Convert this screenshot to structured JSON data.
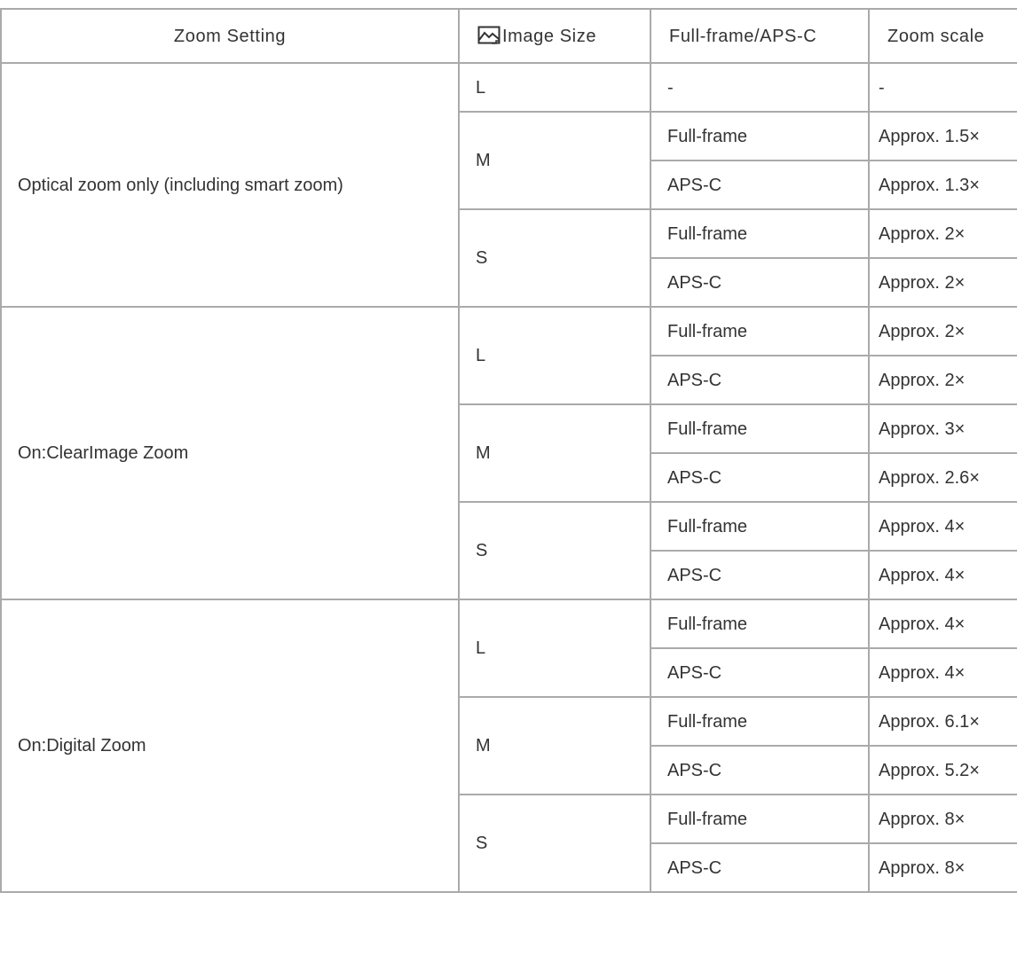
{
  "table": {
    "headers": {
      "zoom_setting": "Zoom Setting",
      "image_size": "Image Size",
      "image_size_icon": "image-size-icon",
      "frame": "Full-frame/APS-C",
      "zoom_scale": "Zoom scale"
    },
    "groups": [
      {
        "setting": "Optical zoom only (including smart zoom)",
        "sizes": [
          {
            "size": "L",
            "rows": [
              {
                "frame": "-",
                "scale": "-"
              }
            ]
          },
          {
            "size": "M",
            "rows": [
              {
                "frame": "Full-frame",
                "scale": "Approx. 1.5×"
              },
              {
                "frame": "APS-C",
                "scale": "Approx. 1.3×"
              }
            ]
          },
          {
            "size": "S",
            "rows": [
              {
                "frame": "Full-frame",
                "scale": "Approx. 2×"
              },
              {
                "frame": "APS-C",
                "scale": "Approx. 2×"
              }
            ]
          }
        ]
      },
      {
        "setting": "On:ClearImage Zoom",
        "sizes": [
          {
            "size": "L",
            "rows": [
              {
                "frame": "Full-frame",
                "scale": "Approx. 2×"
              },
              {
                "frame": "APS-C",
                "scale": "Approx. 2×"
              }
            ]
          },
          {
            "size": "M",
            "rows": [
              {
                "frame": "Full-frame",
                "scale": "Approx. 3×"
              },
              {
                "frame": "APS-C",
                "scale": "Approx. 2.6×"
              }
            ]
          },
          {
            "size": "S",
            "rows": [
              {
                "frame": "Full-frame",
                "scale": "Approx. 4×"
              },
              {
                "frame": "APS-C",
                "scale": "Approx. 4×"
              }
            ]
          }
        ]
      },
      {
        "setting": "On:Digital Zoom",
        "sizes": [
          {
            "size": "L",
            "rows": [
              {
                "frame": "Full-frame",
                "scale": "Approx. 4×"
              },
              {
                "frame": "APS-C",
                "scale": "Approx. 4×"
              }
            ]
          },
          {
            "size": "M",
            "rows": [
              {
                "frame": "Full-frame",
                "scale": "Approx. 6.1×"
              },
              {
                "frame": "APS-C",
                "scale": "Approx. 5.2×"
              }
            ]
          },
          {
            "size": "S",
            "rows": [
              {
                "frame": "Full-frame",
                "scale": "Approx. 8×"
              },
              {
                "frame": "APS-C",
                "scale": "Approx. 8×"
              }
            ]
          }
        ]
      }
    ]
  }
}
